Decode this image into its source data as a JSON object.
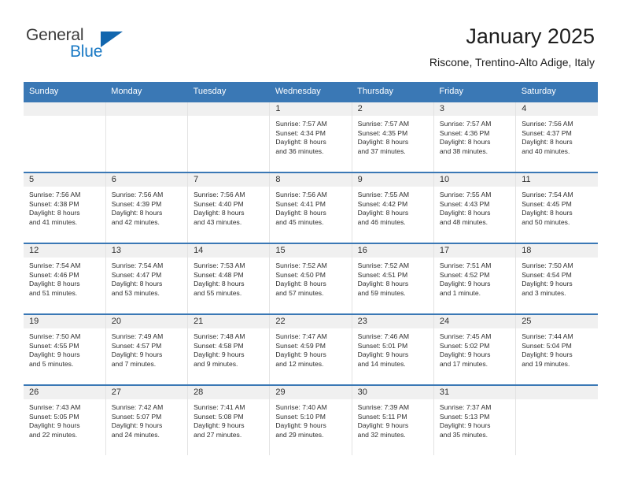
{
  "brand": {
    "name_part1": "General",
    "name_part2": "Blue",
    "triangle_icon": "triangle-icon",
    "accent_color": "#1878c4",
    "triangle_color": "#1266ae"
  },
  "header": {
    "title": "January 2025",
    "subtitle": "Riscone, Trentino-Alto Adige, Italy"
  },
  "calendar": {
    "header_bg": "#3a78b5",
    "daynum_bg": "#f0f0f0",
    "weekdays": [
      "Sunday",
      "Monday",
      "Tuesday",
      "Wednesday",
      "Thursday",
      "Friday",
      "Saturday"
    ],
    "weeks": [
      [
        {
          "day": "",
          "sunrise": "",
          "sunset": "",
          "daylight1": "",
          "daylight2": ""
        },
        {
          "day": "",
          "sunrise": "",
          "sunset": "",
          "daylight1": "",
          "daylight2": ""
        },
        {
          "day": "",
          "sunrise": "",
          "sunset": "",
          "daylight1": "",
          "daylight2": ""
        },
        {
          "day": "1",
          "sunrise": "Sunrise: 7:57 AM",
          "sunset": "Sunset: 4:34 PM",
          "daylight1": "Daylight: 8 hours",
          "daylight2": "and 36 minutes."
        },
        {
          "day": "2",
          "sunrise": "Sunrise: 7:57 AM",
          "sunset": "Sunset: 4:35 PM",
          "daylight1": "Daylight: 8 hours",
          "daylight2": "and 37 minutes."
        },
        {
          "day": "3",
          "sunrise": "Sunrise: 7:57 AM",
          "sunset": "Sunset: 4:36 PM",
          "daylight1": "Daylight: 8 hours",
          "daylight2": "and 38 minutes."
        },
        {
          "day": "4",
          "sunrise": "Sunrise: 7:56 AM",
          "sunset": "Sunset: 4:37 PM",
          "daylight1": "Daylight: 8 hours",
          "daylight2": "and 40 minutes."
        }
      ],
      [
        {
          "day": "5",
          "sunrise": "Sunrise: 7:56 AM",
          "sunset": "Sunset: 4:38 PM",
          "daylight1": "Daylight: 8 hours",
          "daylight2": "and 41 minutes."
        },
        {
          "day": "6",
          "sunrise": "Sunrise: 7:56 AM",
          "sunset": "Sunset: 4:39 PM",
          "daylight1": "Daylight: 8 hours",
          "daylight2": "and 42 minutes."
        },
        {
          "day": "7",
          "sunrise": "Sunrise: 7:56 AM",
          "sunset": "Sunset: 4:40 PM",
          "daylight1": "Daylight: 8 hours",
          "daylight2": "and 43 minutes."
        },
        {
          "day": "8",
          "sunrise": "Sunrise: 7:56 AM",
          "sunset": "Sunset: 4:41 PM",
          "daylight1": "Daylight: 8 hours",
          "daylight2": "and 45 minutes."
        },
        {
          "day": "9",
          "sunrise": "Sunrise: 7:55 AM",
          "sunset": "Sunset: 4:42 PM",
          "daylight1": "Daylight: 8 hours",
          "daylight2": "and 46 minutes."
        },
        {
          "day": "10",
          "sunrise": "Sunrise: 7:55 AM",
          "sunset": "Sunset: 4:43 PM",
          "daylight1": "Daylight: 8 hours",
          "daylight2": "and 48 minutes."
        },
        {
          "day": "11",
          "sunrise": "Sunrise: 7:54 AM",
          "sunset": "Sunset: 4:45 PM",
          "daylight1": "Daylight: 8 hours",
          "daylight2": "and 50 minutes."
        }
      ],
      [
        {
          "day": "12",
          "sunrise": "Sunrise: 7:54 AM",
          "sunset": "Sunset: 4:46 PM",
          "daylight1": "Daylight: 8 hours",
          "daylight2": "and 51 minutes."
        },
        {
          "day": "13",
          "sunrise": "Sunrise: 7:54 AM",
          "sunset": "Sunset: 4:47 PM",
          "daylight1": "Daylight: 8 hours",
          "daylight2": "and 53 minutes."
        },
        {
          "day": "14",
          "sunrise": "Sunrise: 7:53 AM",
          "sunset": "Sunset: 4:48 PM",
          "daylight1": "Daylight: 8 hours",
          "daylight2": "and 55 minutes."
        },
        {
          "day": "15",
          "sunrise": "Sunrise: 7:52 AM",
          "sunset": "Sunset: 4:50 PM",
          "daylight1": "Daylight: 8 hours",
          "daylight2": "and 57 minutes."
        },
        {
          "day": "16",
          "sunrise": "Sunrise: 7:52 AM",
          "sunset": "Sunset: 4:51 PM",
          "daylight1": "Daylight: 8 hours",
          "daylight2": "and 59 minutes."
        },
        {
          "day": "17",
          "sunrise": "Sunrise: 7:51 AM",
          "sunset": "Sunset: 4:52 PM",
          "daylight1": "Daylight: 9 hours",
          "daylight2": "and 1 minute."
        },
        {
          "day": "18",
          "sunrise": "Sunrise: 7:50 AM",
          "sunset": "Sunset: 4:54 PM",
          "daylight1": "Daylight: 9 hours",
          "daylight2": "and 3 minutes."
        }
      ],
      [
        {
          "day": "19",
          "sunrise": "Sunrise: 7:50 AM",
          "sunset": "Sunset: 4:55 PM",
          "daylight1": "Daylight: 9 hours",
          "daylight2": "and 5 minutes."
        },
        {
          "day": "20",
          "sunrise": "Sunrise: 7:49 AM",
          "sunset": "Sunset: 4:57 PM",
          "daylight1": "Daylight: 9 hours",
          "daylight2": "and 7 minutes."
        },
        {
          "day": "21",
          "sunrise": "Sunrise: 7:48 AM",
          "sunset": "Sunset: 4:58 PM",
          "daylight1": "Daylight: 9 hours",
          "daylight2": "and 9 minutes."
        },
        {
          "day": "22",
          "sunrise": "Sunrise: 7:47 AM",
          "sunset": "Sunset: 4:59 PM",
          "daylight1": "Daylight: 9 hours",
          "daylight2": "and 12 minutes."
        },
        {
          "day": "23",
          "sunrise": "Sunrise: 7:46 AM",
          "sunset": "Sunset: 5:01 PM",
          "daylight1": "Daylight: 9 hours",
          "daylight2": "and 14 minutes."
        },
        {
          "day": "24",
          "sunrise": "Sunrise: 7:45 AM",
          "sunset": "Sunset: 5:02 PM",
          "daylight1": "Daylight: 9 hours",
          "daylight2": "and 17 minutes."
        },
        {
          "day": "25",
          "sunrise": "Sunrise: 7:44 AM",
          "sunset": "Sunset: 5:04 PM",
          "daylight1": "Daylight: 9 hours",
          "daylight2": "and 19 minutes."
        }
      ],
      [
        {
          "day": "26",
          "sunrise": "Sunrise: 7:43 AM",
          "sunset": "Sunset: 5:05 PM",
          "daylight1": "Daylight: 9 hours",
          "daylight2": "and 22 minutes."
        },
        {
          "day": "27",
          "sunrise": "Sunrise: 7:42 AM",
          "sunset": "Sunset: 5:07 PM",
          "daylight1": "Daylight: 9 hours",
          "daylight2": "and 24 minutes."
        },
        {
          "day": "28",
          "sunrise": "Sunrise: 7:41 AM",
          "sunset": "Sunset: 5:08 PM",
          "daylight1": "Daylight: 9 hours",
          "daylight2": "and 27 minutes."
        },
        {
          "day": "29",
          "sunrise": "Sunrise: 7:40 AM",
          "sunset": "Sunset: 5:10 PM",
          "daylight1": "Daylight: 9 hours",
          "daylight2": "and 29 minutes."
        },
        {
          "day": "30",
          "sunrise": "Sunrise: 7:39 AM",
          "sunset": "Sunset: 5:11 PM",
          "daylight1": "Daylight: 9 hours",
          "daylight2": "and 32 minutes."
        },
        {
          "day": "31",
          "sunrise": "Sunrise: 7:37 AM",
          "sunset": "Sunset: 5:13 PM",
          "daylight1": "Daylight: 9 hours",
          "daylight2": "and 35 minutes."
        },
        {
          "day": "",
          "sunrise": "",
          "sunset": "",
          "daylight1": "",
          "daylight2": ""
        }
      ]
    ]
  }
}
